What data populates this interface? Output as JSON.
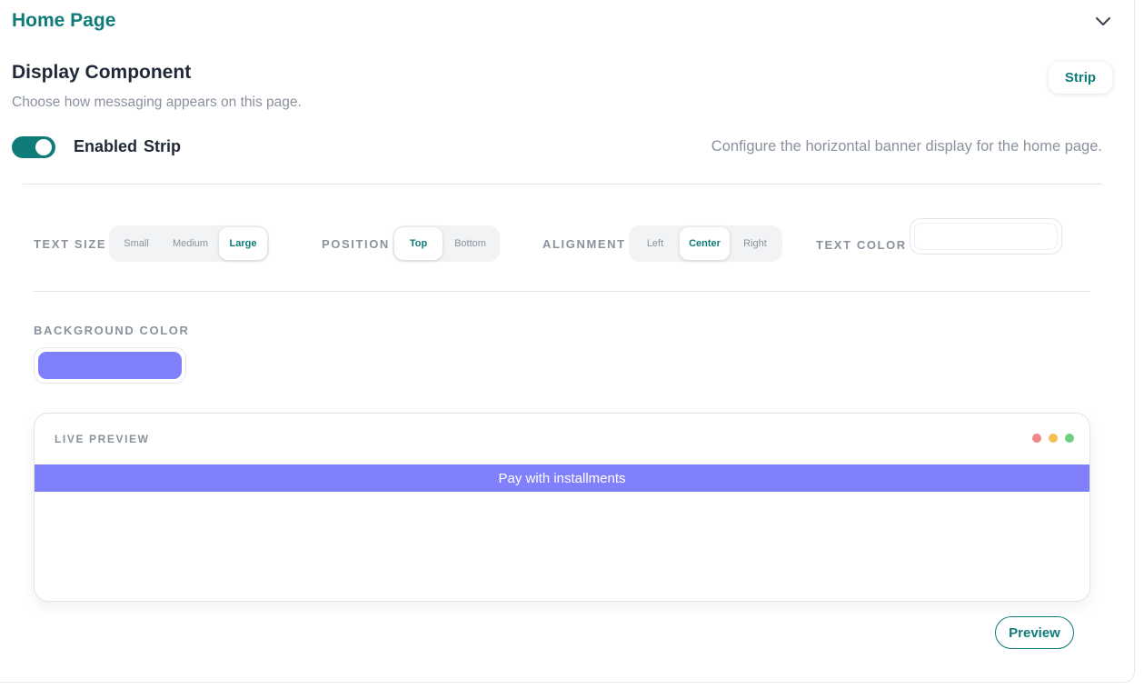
{
  "header": {
    "title": "Home Page"
  },
  "display": {
    "title": "Display Component",
    "subtitle": "Choose how messaging appears on this page.",
    "type_badge": "Strip",
    "enabled_word": "Enabled",
    "enabled_type": "Strip",
    "enabled": true,
    "description": "Configure the horizontal banner display for the home page."
  },
  "controls": {
    "text_size": {
      "label": "TEXT SIZE",
      "options": [
        "Small",
        "Medium",
        "Large"
      ],
      "selected": "Large"
    },
    "position": {
      "label": "POSITION",
      "options": [
        "Top",
        "Bottom"
      ],
      "selected": "Top"
    },
    "alignment": {
      "label": "ALIGNMENT",
      "options": [
        "Left",
        "Center",
        "Right"
      ],
      "selected": "Center"
    },
    "text_color": {
      "label": "TEXT COLOR",
      "value": "#ffffff"
    },
    "background_color": {
      "label": "BACKGROUND COLOR",
      "value": "#8080fc"
    }
  },
  "preview": {
    "label": "LIVE PREVIEW",
    "banner_text": "Pay with installments",
    "dot_colors": [
      "#ee8a8a",
      "#f0c050",
      "#6ccf82"
    ],
    "button_label": "Preview"
  },
  "colors": {
    "accent": "#0f7c7a",
    "muted": "#8a929e"
  },
  "icons": {
    "collapse": "chevron-down-icon"
  }
}
